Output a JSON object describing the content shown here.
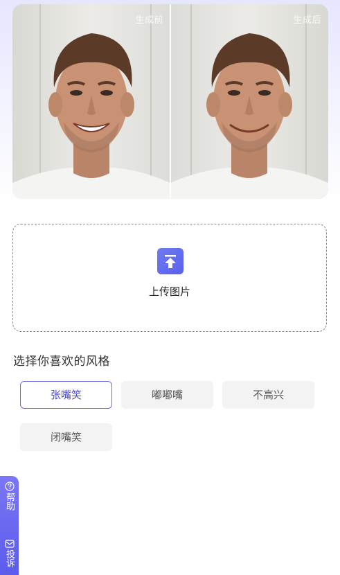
{
  "compare": {
    "before_label": "生成前",
    "after_label": "生成后"
  },
  "upload": {
    "label": "上传图片",
    "icon": "upload-arrow-icon"
  },
  "style_section": {
    "title": "选择你喜欢的风格",
    "selected": "张嘴笑",
    "options": [
      "张嘴笑",
      "嘟嘟嘴",
      "不高兴",
      "闭嘴笑"
    ]
  },
  "side_tab": {
    "help_label": "帮助",
    "help_icon": "question-circle-icon",
    "complaint_label": "投诉",
    "complaint_icon": "mail-icon"
  },
  "colors": {
    "accent": "#5b5cec",
    "selected_border": "#6a6ae6",
    "chip_bg": "#f3f3f3"
  }
}
